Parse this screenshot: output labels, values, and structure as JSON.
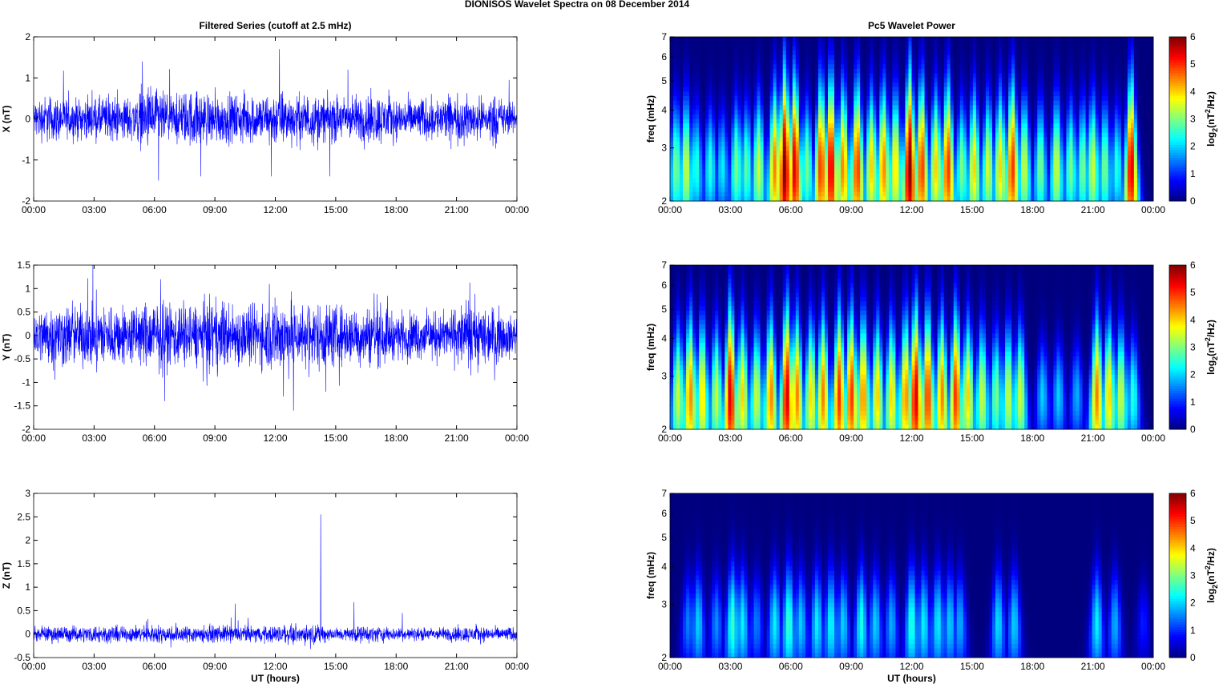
{
  "figure_title": "DIONISOS Wavelet Spectra on 08 December  2014",
  "chart_data": [
    {
      "type": "line",
      "title": "Filtered Series (cutoff at 2.5 mHz)",
      "ylabel": "X (nT)",
      "xlabel": "",
      "ylim": [
        -2,
        2
      ],
      "yticks": [
        "-2",
        "-1",
        "0",
        "1",
        "2"
      ],
      "xticks": [
        "00:00",
        "03:00",
        "06:00",
        "09:00",
        "12:00",
        "15:00",
        "18:00",
        "21:00",
        "00:00"
      ],
      "xlim_hours": [
        0,
        24
      ],
      "color": "#0000ff",
      "base_amplitude": 0.3,
      "spikes": [
        [
          5.4,
          1.4
        ],
        [
          6.2,
          -1.5
        ],
        [
          8.3,
          -1.4
        ],
        [
          11.8,
          -1.4
        ],
        [
          12.2,
          1.7
        ],
        [
          14.7,
          -1.4
        ],
        [
          15.6,
          1.2
        ],
        [
          23.6,
          0.95
        ]
      ]
    },
    {
      "type": "line",
      "title": "",
      "ylabel": "Y (nT)",
      "xlabel": "",
      "ylim": [
        -2,
        1.5
      ],
      "yticks": [
        "-2",
        "-1.5",
        "-1",
        "-0.5",
        "0",
        "0.5",
        "1",
        "1.5"
      ],
      "xticks": [
        "00:00",
        "03:00",
        "06:00",
        "09:00",
        "12:00",
        "15:00",
        "18:00",
        "21:00",
        "00:00"
      ],
      "xlim_hours": [
        0,
        24
      ],
      "color": "#0000ff",
      "base_amplitude": 0.35,
      "spikes": [
        [
          6.3,
          1.2
        ],
        [
          6.5,
          -1.4
        ],
        [
          11.7,
          1.1
        ],
        [
          12.4,
          -1.3
        ],
        [
          12.9,
          -1.6
        ],
        [
          14.5,
          -1.2
        ],
        [
          16.9,
          0.9
        ],
        [
          21.7,
          -0.85
        ]
      ]
    },
    {
      "type": "line",
      "title": "",
      "ylabel": "Z (nT)",
      "xlabel": "UT (hours)",
      "ylim": [
        -0.5,
        3
      ],
      "yticks": [
        "-0.5",
        "0",
        "0.5",
        "1",
        "1.5",
        "2",
        "2.5",
        "3"
      ],
      "xticks": [
        "00:00",
        "03:00",
        "06:00",
        "09:00",
        "12:00",
        "15:00",
        "18:00",
        "21:00",
        "00:00"
      ],
      "xlim_hours": [
        0,
        24
      ],
      "color": "#0000ff",
      "base_amplitude": 0.12,
      "spikes": [
        [
          10,
          0.65
        ],
        [
          14.25,
          2.55
        ],
        [
          15.9,
          0.68
        ],
        [
          18.3,
          0.45
        ]
      ]
    },
    {
      "type": "heatmap",
      "title": "Pc5 Wavelet Power",
      "ylabel": "freq (mHz)",
      "xlabel": "",
      "yscale": "log",
      "ylim": [
        2,
        7
      ],
      "yticks": [
        "2",
        "3",
        "4",
        "5",
        "6",
        "7"
      ],
      "xticks": [
        "00:00",
        "03:00",
        "06:00",
        "09:00",
        "12:00",
        "15:00",
        "18:00",
        "21:00",
        "00:00"
      ],
      "colorbar": {
        "label": "log2(nT2/Hz)",
        "range": [
          0,
          6
        ],
        "ticks": [
          "0",
          "1",
          "2",
          "3",
          "4",
          "5",
          "6"
        ],
        "colormap": "jet"
      },
      "peaks_hours_power": [
        [
          0.3,
          3
        ],
        [
          0.8,
          3.5
        ],
        [
          1.3,
          2.5
        ],
        [
          2,
          2.5
        ],
        [
          2.6,
          2.2
        ],
        [
          3.3,
          3
        ],
        [
          3.8,
          2.8
        ],
        [
          4.4,
          3.5
        ],
        [
          5.2,
          4.5
        ],
        [
          5.7,
          6
        ],
        [
          6.2,
          5.5
        ],
        [
          6.8,
          3
        ],
        [
          7.5,
          5
        ],
        [
          8,
          5.5
        ],
        [
          8.6,
          4.5
        ],
        [
          9.3,
          5
        ],
        [
          10,
          4
        ],
        [
          10.6,
          4.5
        ],
        [
          11.2,
          4
        ],
        [
          11.9,
          6
        ],
        [
          12.5,
          5
        ],
        [
          13.2,
          4
        ],
        [
          13.8,
          5
        ],
        [
          14.5,
          3
        ],
        [
          15.1,
          4
        ],
        [
          15.8,
          3.5
        ],
        [
          16.4,
          4
        ],
        [
          17,
          5
        ],
        [
          17.6,
          3.5
        ],
        [
          18.4,
          3
        ],
        [
          19.2,
          3.5
        ],
        [
          19.9,
          3
        ],
        [
          20.5,
          3
        ],
        [
          21,
          3.5
        ],
        [
          21.6,
          3
        ],
        [
          22.2,
          2.5
        ],
        [
          22.9,
          5.5
        ]
      ]
    },
    {
      "type": "heatmap",
      "title": "",
      "ylabel": "freq (mHz)",
      "xlabel": "",
      "yscale": "log",
      "ylim": [
        2,
        7
      ],
      "yticks": [
        "2",
        "3",
        "4",
        "5",
        "6",
        "7"
      ],
      "xticks": [
        "00:00",
        "03:00",
        "06:00",
        "09:00",
        "12:00",
        "15:00",
        "18:00",
        "21:00",
        "00:00"
      ],
      "colorbar": {
        "label": "log2(nT2/Hz)",
        "range": [
          0,
          6
        ],
        "ticks": [
          "0",
          "1",
          "2",
          "3",
          "4",
          "5",
          "6"
        ],
        "colormap": "jet"
      },
      "peaks_hours_power": [
        [
          0.4,
          3.5
        ],
        [
          1,
          4.5
        ],
        [
          1.6,
          4
        ],
        [
          2.3,
          3.5
        ],
        [
          3,
          5.5
        ],
        [
          3.6,
          4
        ],
        [
          4.3,
          3.5
        ],
        [
          5,
          4.5
        ],
        [
          5.8,
          5.5
        ],
        [
          6.3,
          4.5
        ],
        [
          7,
          4
        ],
        [
          7.6,
          4.5
        ],
        [
          8.4,
          5
        ],
        [
          9,
          5
        ],
        [
          9.6,
          4.5
        ],
        [
          10.3,
          4
        ],
        [
          11,
          4
        ],
        [
          11.7,
          4.5
        ],
        [
          12.2,
          5.5
        ],
        [
          12.8,
          5
        ],
        [
          13.5,
          4.5
        ],
        [
          14.2,
          5
        ],
        [
          14.8,
          4
        ],
        [
          15.5,
          3.5
        ],
        [
          16.2,
          3
        ],
        [
          16.8,
          3.5
        ],
        [
          17.4,
          3.5
        ],
        [
          18.5,
          2
        ],
        [
          19.3,
          2
        ],
        [
          20.2,
          1.8
        ],
        [
          21.2,
          4.5
        ],
        [
          21.8,
          4
        ],
        [
          22.4,
          3.5
        ],
        [
          23,
          2.5
        ]
      ]
    },
    {
      "type": "heatmap",
      "title": "",
      "ylabel": "freq (mHz)",
      "xlabel": "UT (hours)",
      "yscale": "log",
      "ylim": [
        2,
        7
      ],
      "yticks": [
        "2",
        "3",
        "4",
        "5",
        "6",
        "7"
      ],
      "xticks": [
        "00:00",
        "03:00",
        "06:00",
        "09:00",
        "12:00",
        "15:00",
        "18:00",
        "21:00",
        "00:00"
      ],
      "colorbar": {
        "label": "log2(nT2/Hz)",
        "range": [
          0,
          6
        ],
        "ticks": [
          "0",
          "1",
          "2",
          "3",
          "4",
          "5",
          "6"
        ],
        "colormap": "jet"
      },
      "peaks_hours_power": [
        [
          0.9,
          1.5
        ],
        [
          1.4,
          2
        ],
        [
          2.3,
          1.6
        ],
        [
          3.1,
          2.6
        ],
        [
          3.6,
          2.2
        ],
        [
          4.3,
          1.5
        ],
        [
          5.2,
          2.2
        ],
        [
          5.9,
          2.6
        ],
        [
          6.5,
          2
        ],
        [
          7.3,
          2.2
        ],
        [
          8,
          2.3
        ],
        [
          8.6,
          2
        ],
        [
          9.5,
          2.4
        ],
        [
          10.2,
          2
        ],
        [
          11,
          1.8
        ],
        [
          12,
          2.5
        ],
        [
          12.6,
          2.2
        ],
        [
          13.3,
          2.2
        ],
        [
          13.9,
          2
        ],
        [
          14.4,
          1.8
        ],
        [
          16.3,
          2.1
        ],
        [
          17.1,
          2
        ],
        [
          21.2,
          2.2
        ],
        [
          22.1,
          1.8
        ],
        [
          23.5,
          0.9
        ]
      ]
    }
  ]
}
